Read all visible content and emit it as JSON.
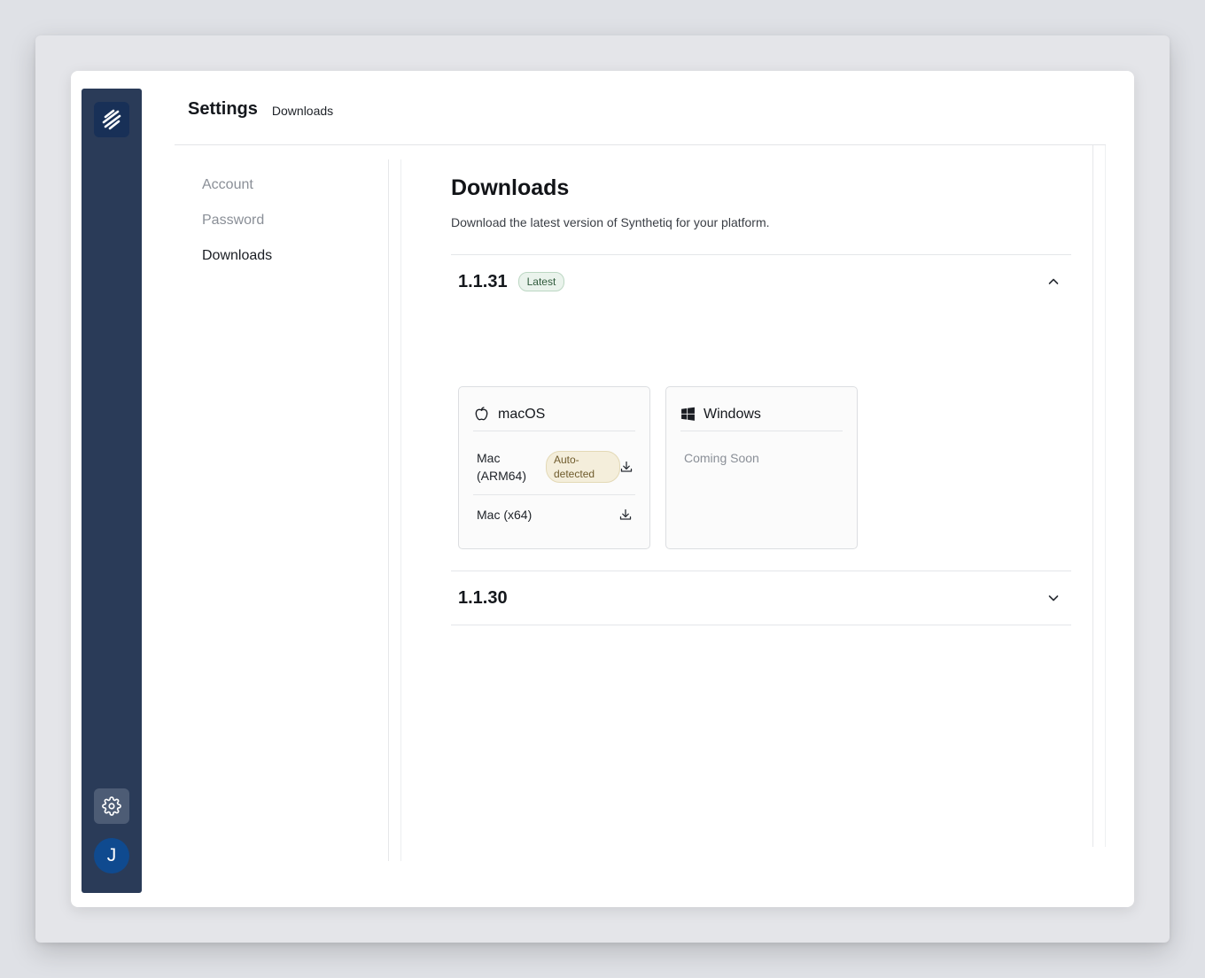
{
  "rail": {
    "avatar_initial": "J"
  },
  "header": {
    "title": "Settings",
    "breadcrumb": "Downloads"
  },
  "subnav": {
    "items": [
      {
        "label": "Account",
        "active": false
      },
      {
        "label": "Password",
        "active": false
      },
      {
        "label": "Downloads",
        "active": true
      }
    ]
  },
  "main": {
    "title": "Downloads",
    "description": "Download the latest version of Synthetiq for your platform.",
    "versions": [
      {
        "version": "1.1.31",
        "badge": "Latest",
        "expanded": true,
        "platforms": {
          "macos": {
            "name": "macOS",
            "icon": "apple-icon",
            "downloads": [
              {
                "label": "Mac (ARM64)",
                "badge": "Auto-detected"
              },
              {
                "label": "Mac (x64)"
              }
            ]
          },
          "windows": {
            "name": "Windows",
            "icon": "windows-icon",
            "status": "Coming Soon"
          }
        }
      },
      {
        "version": "1.1.30",
        "expanded": false
      }
    ]
  },
  "colors": {
    "rail": "#2a3b58",
    "logo_bg": "#183057",
    "avatar_bg": "#0f4a8f",
    "latest_badge_bg": "#eaf3ec",
    "auto_badge_bg": "#f4eedb"
  }
}
